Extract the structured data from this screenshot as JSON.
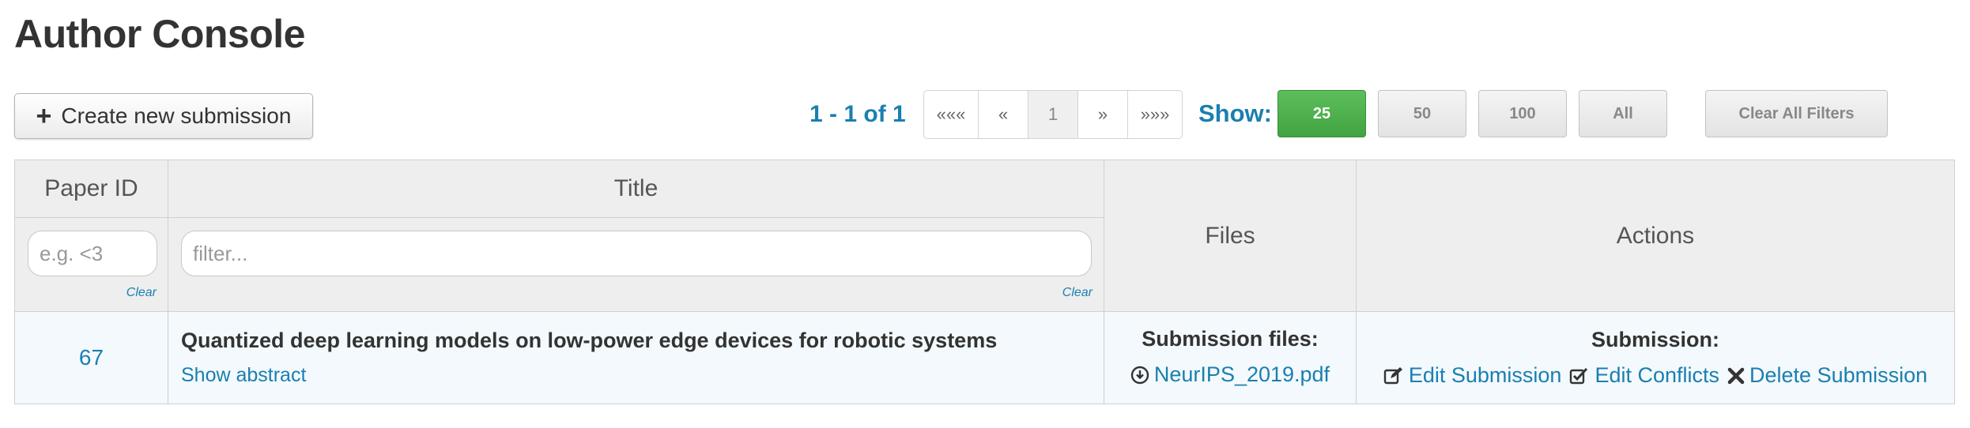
{
  "page": {
    "title": "Author Console"
  },
  "toolbar": {
    "create_label": "Create new submission",
    "range_text": "1 - 1 of 1",
    "pager": {
      "first": "«««",
      "prev": "«",
      "current": "1",
      "next": "»",
      "last": "»»»"
    },
    "show_label": "Show:",
    "show_options": [
      "25",
      "50",
      "100",
      "All"
    ],
    "show_selected": "25",
    "clear_filters_label": "Clear All Filters"
  },
  "table": {
    "headers": {
      "paper_id": "Paper ID",
      "title": "Title",
      "files": "Files",
      "actions": "Actions"
    },
    "filters": {
      "paper_id_placeholder": "e.g. <3",
      "title_placeholder": "filter...",
      "clear_label": "Clear"
    },
    "rows": [
      {
        "paper_id": "67",
        "title": "Quantized deep learning models on low-power edge devices for robotic systems",
        "show_abstract": "Show abstract",
        "files_heading": "Submission files:",
        "file_name": "NeurIPS_2019.pdf",
        "actions_heading": "Submission:",
        "edit_submission": "Edit Submission",
        "edit_conflicts": "Edit Conflicts",
        "delete_submission": "Delete Submission"
      }
    ]
  },
  "colors": {
    "link": "#1a7fb0",
    "active_show": "#4cae4c",
    "row_bg": "#f3f9fc",
    "header_bg": "#eeeeee"
  },
  "icons": [
    "plus-icon",
    "download-icon",
    "edit-icon",
    "check-square-icon",
    "times-icon"
  ]
}
